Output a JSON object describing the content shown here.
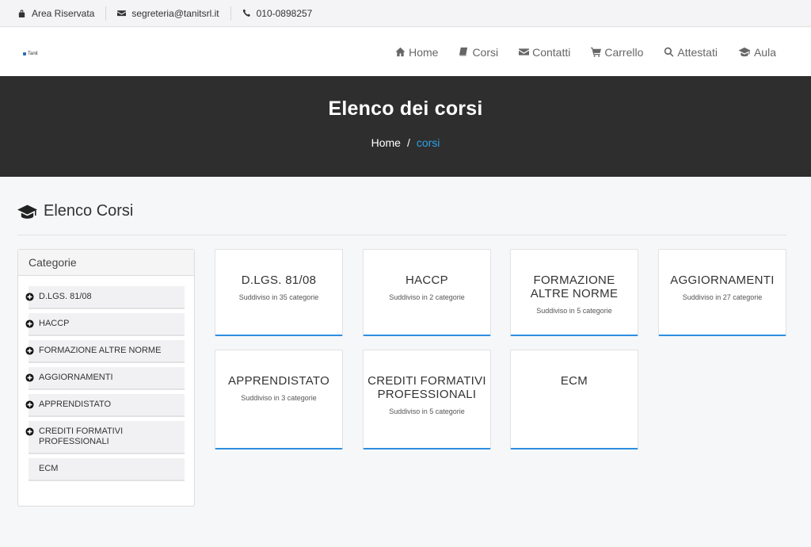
{
  "topbar": {
    "reserved": "Area Riservata",
    "email": "segreteria@tanitsrl.it",
    "phone": "010-0898257"
  },
  "logo": {
    "text": "Tanit"
  },
  "nav": {
    "home": "Home",
    "corsi": "Corsi",
    "contatti": "Contatti",
    "carrello": "Carrello",
    "attestati": "Attestati",
    "aula": "Aula"
  },
  "hero": {
    "title": "Elenco dei corsi",
    "breadcrumb_home": "Home",
    "breadcrumb_sep": "/",
    "breadcrumb_current": "corsi"
  },
  "section": {
    "heading": "Elenco Corsi"
  },
  "sidebar": {
    "title": "Categorie",
    "items": [
      {
        "label": "D.LGS. 81/08"
      },
      {
        "label": "HACCP"
      },
      {
        "label": "FORMAZIONE ALTRE NORME"
      },
      {
        "label": "AGGIORNAMENTI"
      },
      {
        "label": "APPRENDISTATO"
      },
      {
        "label": "CREDITI FORMATIVI PROFESSIONALI"
      },
      {
        "label": "ECM"
      }
    ]
  },
  "cards": [
    {
      "title": "D.LGS. 81/08",
      "sub": "Suddiviso in 35 categorie"
    },
    {
      "title": "HACCP",
      "sub": "Suddiviso in 2 categorie"
    },
    {
      "title": "FORMAZIONE ALTRE NORME",
      "sub": "Suddiviso in 5 categorie"
    },
    {
      "title": "AGGIORNAMENTI",
      "sub": "Suddiviso in 27 categorie"
    },
    {
      "title": "APPRENDISTATO",
      "sub": "Suddiviso in 3 categorie"
    },
    {
      "title": "CREDITI FORMATIVI PROFESSIONALI",
      "sub": "Suddiviso in 5 categorie"
    },
    {
      "title": "ECM",
      "sub": ""
    }
  ],
  "colors": {
    "accent": "#2d8fe0",
    "breadcrumb_current": "#2ca1e8",
    "hero_bg": "#2e2e2e"
  }
}
